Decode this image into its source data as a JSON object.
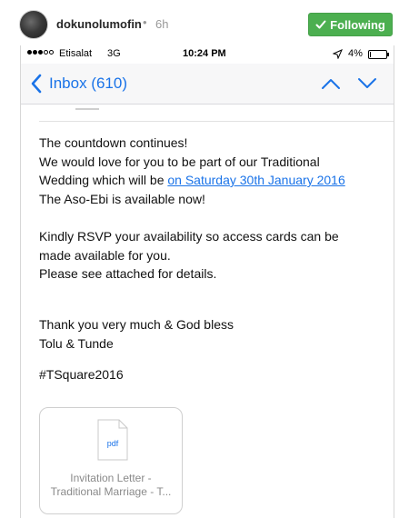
{
  "post": {
    "username": "dokunolumofin",
    "separator": "•",
    "time_ago": "6h",
    "follow_label": "Following",
    "follow_color": "#4caf50"
  },
  "status_bar": {
    "carrier": "Etisalat",
    "network": "3G",
    "time": "10:24 PM",
    "battery_pct": "4%",
    "battery_level": 0.04,
    "signal_filled": 3,
    "signal_total": 5
  },
  "nav": {
    "back_label": "Inbox (610)",
    "accent_color": "#1a73e8",
    "prev_icon": "chevron-up-icon",
    "next_icon": "chevron-down-icon"
  },
  "email": {
    "line1": "The countdown continues!",
    "line2": "We would love for you to be part of our Traditional",
    "line3_prefix": "Wedding which will be ",
    "line3_link": "on Saturday 30th January 2016",
    "line4": "The Aso-Ebi is available now!",
    "line5": "Kindly RSVP your availability so access cards can be",
    "line6": "made available for you.",
    "line7": "Please see attached for details.",
    "line8": "Thank you very much & God bless",
    "line9": "Tolu & Tunde",
    "line10": "#TSquare2016"
  },
  "attachment": {
    "icon_label": "pdf",
    "name_line1": "Invitation Letter -",
    "name_line2": "Traditional Marriage - T..."
  }
}
